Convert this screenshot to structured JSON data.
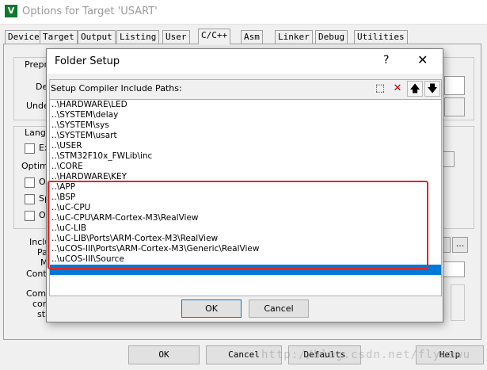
{
  "window": {
    "title": "Options for Target 'USART'",
    "icon_glyph": "V",
    "tabs": [
      "Device",
      "Target",
      "Output",
      "Listing",
      "User",
      "C/C++",
      "Asm",
      "Linker",
      "Debug",
      "Utilities"
    ],
    "active_tab": "C/C++"
  },
  "background_labels": {
    "preprocessor": "Preproc",
    "define": "De",
    "undefine": "Unde",
    "language": "Langu",
    "execute_only": "Ex",
    "optimization": "Optimiz",
    "option_1": "Op",
    "option_2": "Sp",
    "option_3": "Or",
    "include_1": "Inclu",
    "include_2": "Pa",
    "include_3": "M",
    "include_4": "Contr",
    "compiler_1": "Comp",
    "compiler_2": "cont",
    "compiler_3": "str",
    "browse_button": "..."
  },
  "bottom_buttons": {
    "ok": "OK",
    "cancel": "Cancel",
    "defaults": "Defaults",
    "help": "Help"
  },
  "watermark": "http://blog.csdn.net/flywuwu",
  "dialog": {
    "title": "Folder Setup",
    "help_glyph": "?",
    "close_glyph": "✕",
    "list_label": "Setup Compiler Include Paths:",
    "toolbar": {
      "new_glyph": "⬚",
      "delete_glyph": "✕",
      "up_glyph": "🡅",
      "down_glyph": "🡇"
    },
    "paths": [
      "..\\HARDWARE\\LED",
      "..\\SYSTEM\\delay",
      "..\\SYSTEM\\sys",
      "..\\SYSTEM\\usart",
      "..\\USER",
      "..\\STM32F10x_FWLib\\inc",
      "..\\CORE",
      "..\\HARDWARE\\KEY",
      "..\\APP",
      "..\\BSP",
      "..\\uC-CPU",
      "..\\uC-CPU\\ARM-Cortex-M3\\RealView",
      "..\\uC-LIB",
      "..\\uC-LIB\\Ports\\ARM-Cortex-M3\\RealView",
      "..\\uCOS-III\\Ports\\ARM-Cortex-M3\\Generic\\RealView",
      "..\\uCOS-III\\Source"
    ],
    "ok_label": "OK",
    "cancel_label": "Cancel"
  },
  "colors": {
    "selection": "#0078d7",
    "highlight_box": "#e02828"
  }
}
